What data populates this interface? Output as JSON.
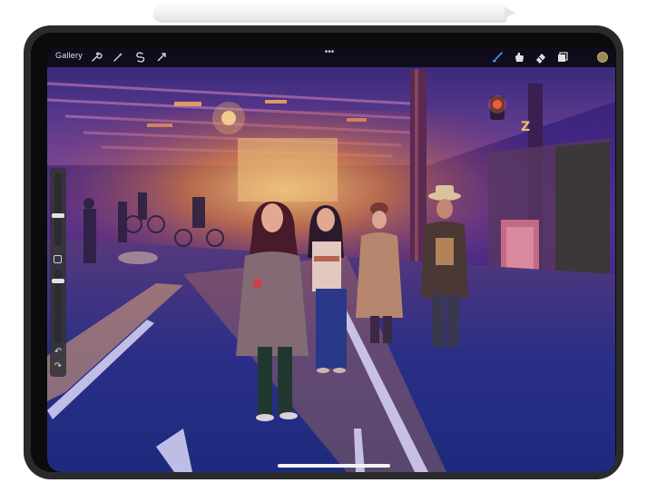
{
  "toolbar": {
    "gallery_label": "Gallery",
    "more_label": "•••",
    "actions_icons": [
      "wrench-icon",
      "magic-wand-icon",
      "selection-icon",
      "transform-arrow-icon"
    ],
    "tools_icons": [
      "brush-icon",
      "smudge-icon",
      "eraser-icon",
      "layers-icon"
    ],
    "active_tool": "brush-icon",
    "current_color": "#9c8b58",
    "accent": "#4aa3ff"
  },
  "sidebar": {
    "brush_size_level": 0.62,
    "opacity_level": 0.4,
    "undo_label": "↶",
    "redo_label": "↷"
  },
  "artwork": {
    "sign_text": "Z"
  }
}
